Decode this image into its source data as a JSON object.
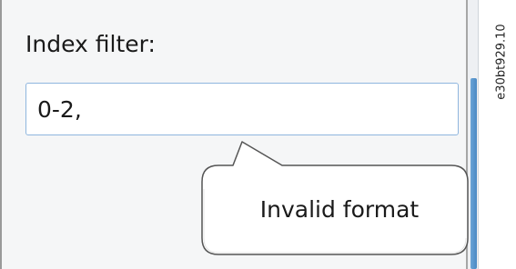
{
  "filter": {
    "label": "Index filter:",
    "value": "0-2,"
  },
  "tooltip": {
    "message": "Invalid format"
  },
  "figure": {
    "code": "e30bt929.10"
  },
  "colors": {
    "input_border": "#8fb6de",
    "scroll_thumb": "#4a89c4",
    "tooltip_border": "#555555"
  }
}
